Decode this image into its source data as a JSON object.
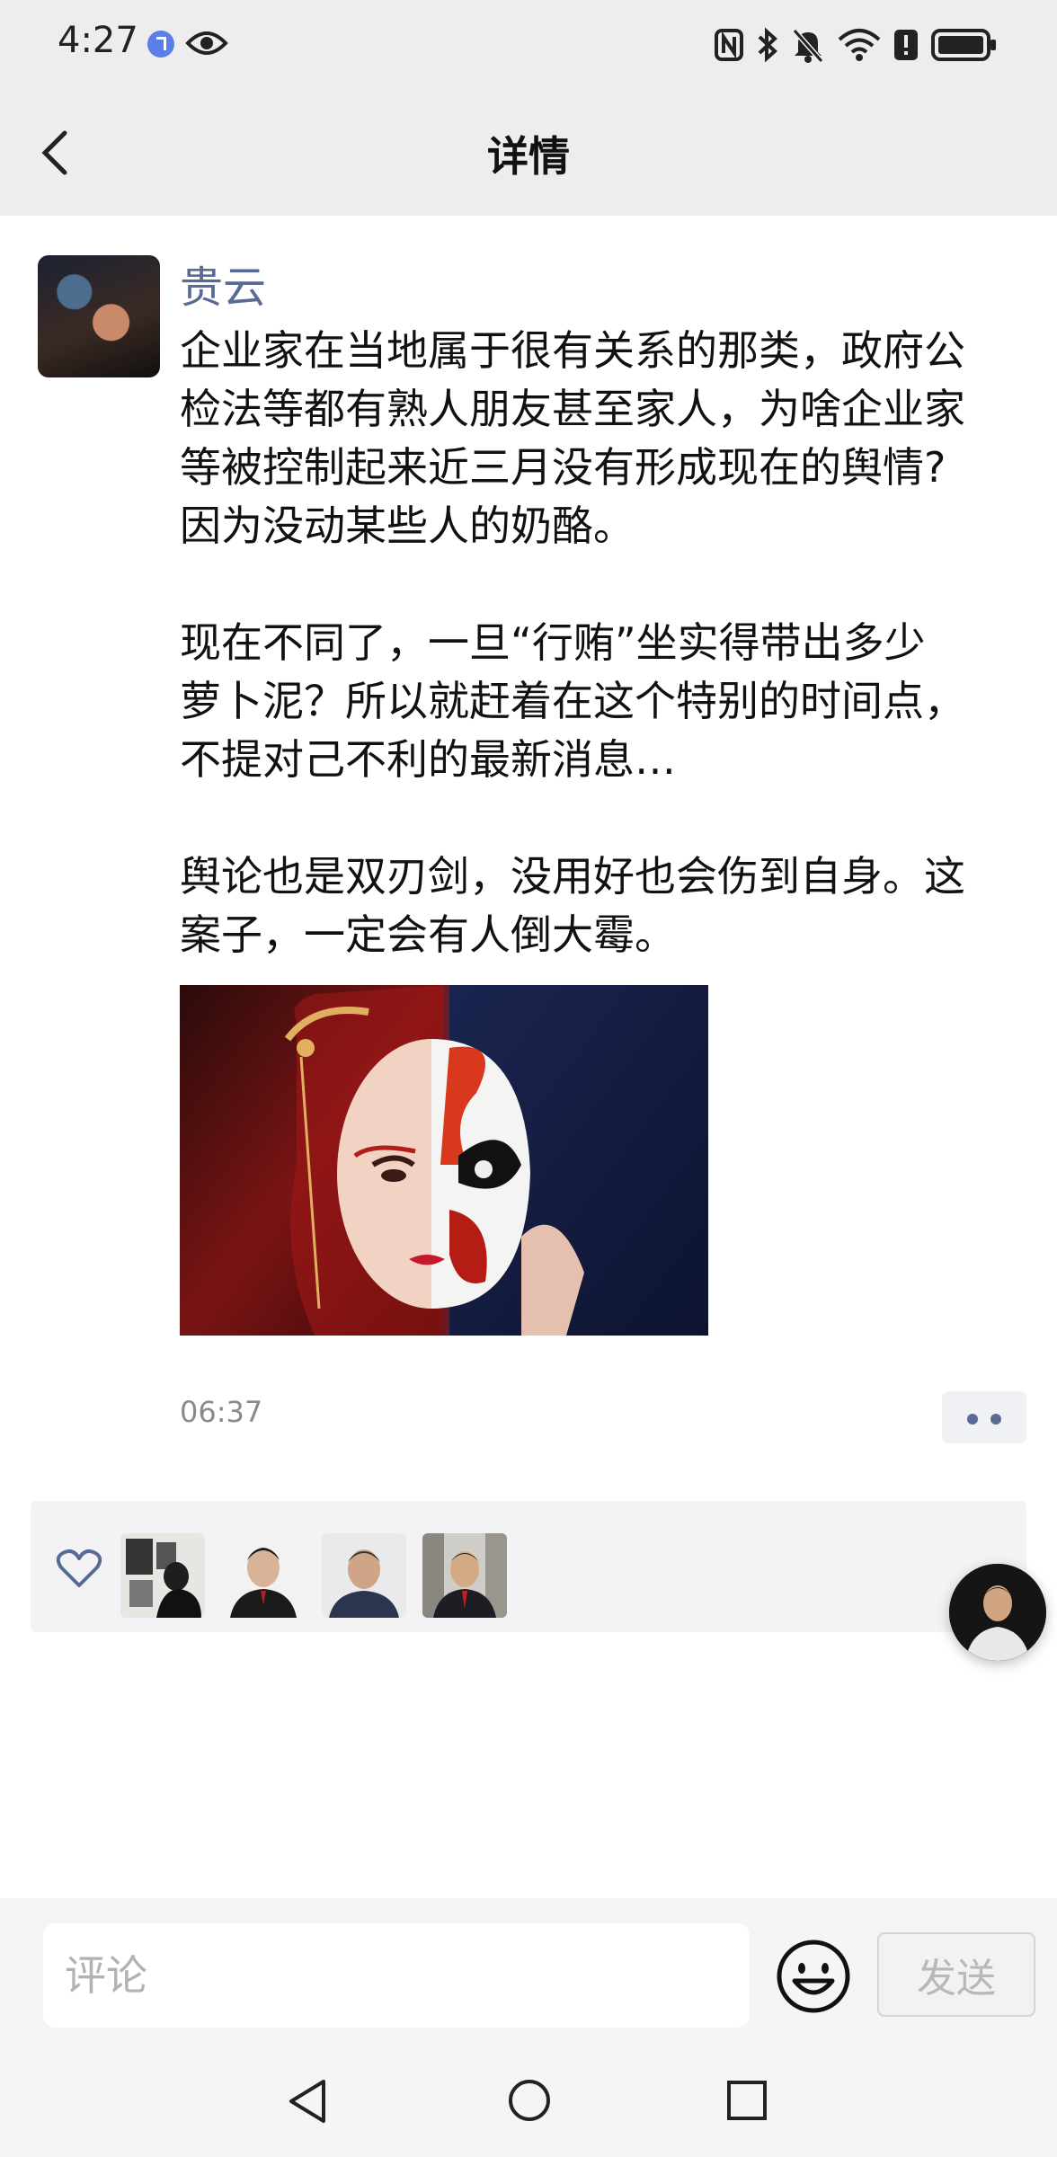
{
  "status_bar": {
    "time": "4:27",
    "icons": [
      "music-icon",
      "eye-icon",
      "nfc-icon",
      "bluetooth-icon",
      "mute-icon",
      "wifi-icon",
      "alert-icon",
      "battery-icon"
    ]
  },
  "header": {
    "title": "详情",
    "back_icon": "chevron-left-icon"
  },
  "post": {
    "author": "贵云",
    "text_lines": [
      "企业家在当地属于很有关系的那类，政府公",
      "检法等都有熟人朋友甚至家人，为啥企业家",
      "等被控制起来近三月没有形成现在的舆情?",
      "因为没动某些人的奶酪。",
      "现在不同了，一旦“行贿”坐实得带出多少",
      "萝卜泥？所以就赶着在这个特别的时间点，",
      "不提对己不利的最新消息…",
      "舆论也是双刃剑，没用好也会伤到自身。这",
      "案子，一定会有人倒大霉。"
    ],
    "image_icon": "opera-mask-image",
    "time": "06:37",
    "more_icon": "more-dots-icon"
  },
  "likes": {
    "heart_icon": "heart-outline-icon",
    "avatar_count": 4
  },
  "comment_bar": {
    "placeholder": "评论",
    "emoji_icon": "smiley-face-icon",
    "send_label": "发送"
  },
  "colors": {
    "link_blue": "#576b95",
    "bar_gray": "#ededed"
  }
}
